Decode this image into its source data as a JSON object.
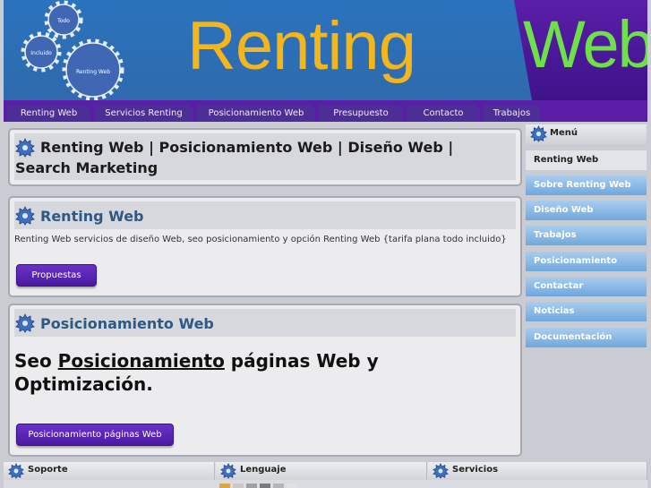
{
  "header": {
    "logo_left": "Renting",
    "logo_right": "Web",
    "gear_labels": [
      "Todo",
      "Incluido",
      "Renting Web"
    ]
  },
  "nav": {
    "tabs": [
      "Renting Web",
      "Servicios Renting",
      "Posicionamiento Web",
      "Presupuesto",
      "Contacto",
      "Trabajos"
    ]
  },
  "main": {
    "page_title": "Renting Web | Posicionamiento Web | Diseño Web | Search Marketing",
    "section1": {
      "title": "Renting Web",
      "description": "Renting Web servicios de diseño Web, seo posicionamiento y opción Renting Web {tarifa plana todo incluido}",
      "button": "Propuestas"
    },
    "section2": {
      "title": "Posicionamiento Web",
      "headline_before": "Seo ",
      "headline_link": "Posicionamiento",
      "headline_after": " páginas Web y Optimización.",
      "button": "Posicionamiento páginas Web"
    }
  },
  "sidebar": {
    "title": "Menú",
    "items": [
      "Renting Web",
      "Sobre Renting Web",
      "Diseño Web",
      "Trabajos",
      "Posicionamiento",
      "Contactar",
      "Noticias",
      "Documentación"
    ]
  },
  "footer": {
    "columns": [
      "Soporte",
      "Lenguaje",
      "Servicios"
    ]
  },
  "colors": {
    "nav_bg": "#5a1ea6",
    "accent_blue_link": "#2d5984",
    "button": "#5a24b8",
    "logo_orange": "#f5b51c",
    "logo_green": "#6ee04a"
  }
}
